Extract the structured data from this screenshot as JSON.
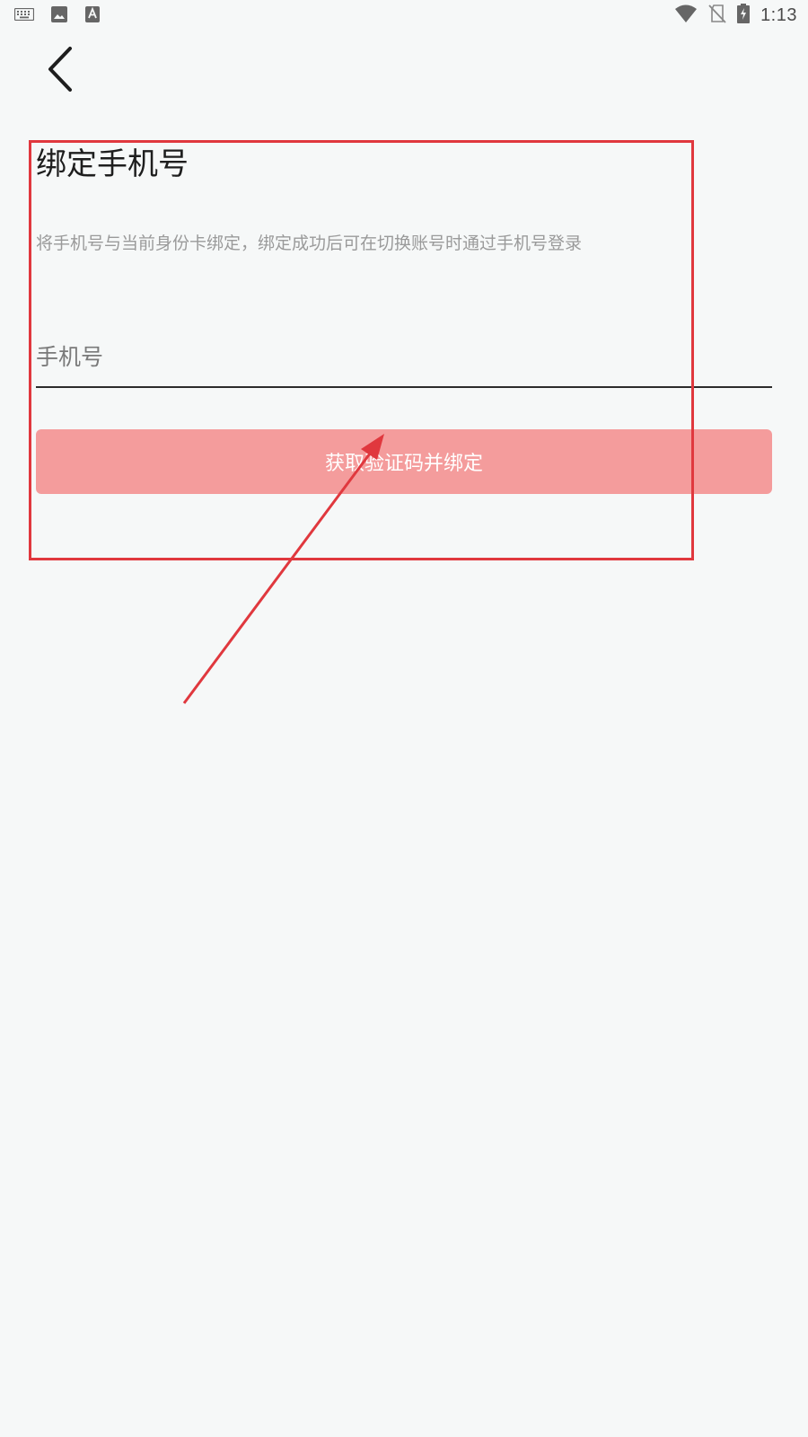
{
  "status_bar": {
    "time": "1:13",
    "icons_left": [
      "keyboard-icon",
      "image-icon",
      "font-download-icon"
    ],
    "icons_right": [
      "wifi-icon",
      "no-sim-icon",
      "battery-charging-icon"
    ]
  },
  "header": {
    "back_icon": "chevron-left-icon"
  },
  "page": {
    "title": "绑定手机号",
    "subtitle": "将手机号与当前身份卡绑定，绑定成功后可在切换账号时通过手机号登录",
    "phone_placeholder": "手机号",
    "phone_value": "",
    "bind_button_label": "获取验证码并绑定"
  },
  "colors": {
    "background": "#f6f8f8",
    "button_fill": "#f49c9c",
    "annotation": "#e0383e",
    "title_text": "#1e1e1e",
    "subtitle_text": "#9a9a9a"
  }
}
